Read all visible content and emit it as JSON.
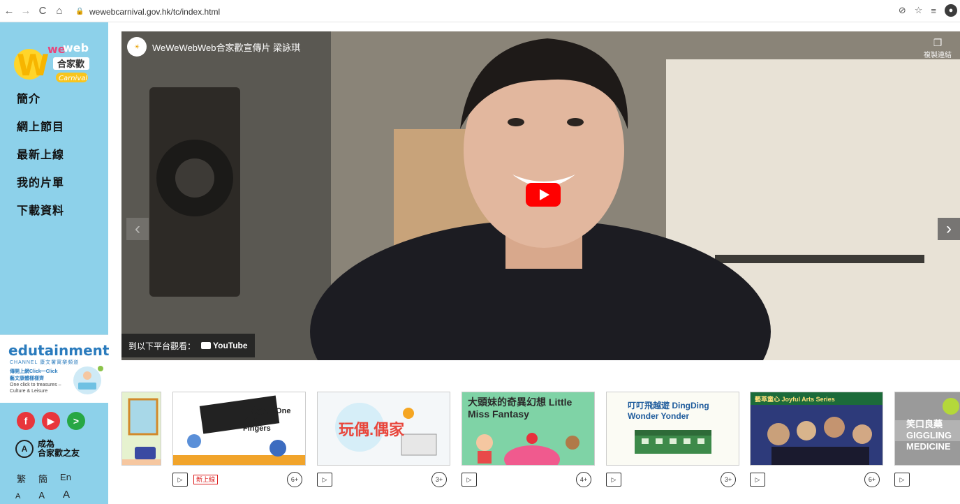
{
  "browser": {
    "url": "wewebcarnival.gov.hk/tc/index.html",
    "back": "←",
    "forward": "→",
    "reload": "C",
    "home": "⌂"
  },
  "sidebar": {
    "logo_text_top": "wewebweb",
    "logo_text_cn": "合家歡",
    "logo_text_carnival": "Carnival",
    "menu": [
      {
        "label": "簡介"
      },
      {
        "label": "網上節目"
      },
      {
        "label": "最新上線"
      },
      {
        "label": "我的片單"
      },
      {
        "label": "下載資料"
      }
    ],
    "edutainment": {
      "title": "edutainment",
      "subtitle": "CHANNEL 康文署寓樂頻道",
      "line1": "傳開上網Click一Click",
      "line2": "藝文康體樣樣齊",
      "line3": "One click to treasures –",
      "line4": "Culture & Leisure"
    },
    "friend_line1": "成為",
    "friend_line2": "合家歡之友",
    "languages": [
      "繁",
      "簡",
      "En"
    ],
    "font_sizes": [
      "A",
      "A",
      "A"
    ]
  },
  "video": {
    "title": "WeWeWebWeb合家歡宣傳片 梁詠琪",
    "copy_link": "複製連結",
    "watch_on": "到以下平台觀看：",
    "youtube": "YouTube"
  },
  "carousel": {
    "cards": [
      {
        "title": "",
        "age": "",
        "new": ""
      },
      {
        "title": "一家幾口 One Song Ten Fingers",
        "age": "6+",
        "new": "新上線"
      },
      {
        "title": "玩偶.偶家",
        "age": "3+",
        "new": ""
      },
      {
        "title": "大頭妹的奇異幻想 Little Miss Fantasy",
        "age": "4+",
        "new": ""
      },
      {
        "title": "叮叮飛越遊 DingDing Wonder Yonder",
        "age": "3+",
        "new": ""
      },
      {
        "title": "藝萃童心 Joyful Arts Series",
        "age": "6+",
        "new": ""
      },
      {
        "title": "笑口良藥 GIGGLING MEDICINE",
        "age": "",
        "new": ""
      }
    ]
  },
  "colors": {
    "sidebar": "#8dd1ea",
    "youtube_red": "#ff0000",
    "new_badge": "#dd2222"
  }
}
